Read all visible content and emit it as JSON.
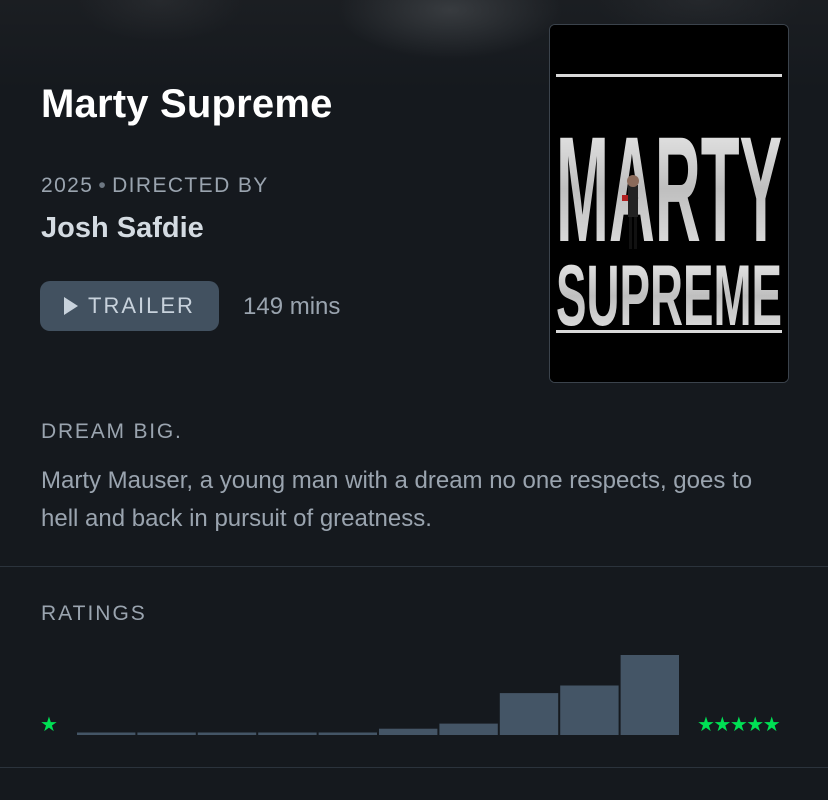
{
  "film": {
    "title": "Marty Supreme",
    "year": "2025",
    "directed_by_label": "DIRECTED BY",
    "director": "Josh Safdie",
    "trailer_label": "TRAILER",
    "runtime": "149 mins",
    "tagline": "DREAM BIG.",
    "synopsis": "Marty Mauser, a young man with a dream no one respects, goes to hell and back in pursuit of greatness."
  },
  "poster": {
    "line1": "MARTY",
    "line2": "SUPREME"
  },
  "ratings": {
    "label": "RATINGS",
    "min_star": "★",
    "max_stars": "★★★★★"
  },
  "colors": {
    "accent_green": "#00e054",
    "bar": "#445566",
    "background": "#15191e"
  },
  "icons": {
    "play": "play-icon"
  },
  "chart_data": {
    "type": "bar",
    "categories": [
      "0.5",
      "1",
      "1.5",
      "2",
      "2.5",
      "3",
      "3.5",
      "4",
      "4.5",
      "5"
    ],
    "values": [
      2,
      2,
      2,
      2,
      2,
      5,
      9,
      33,
      39,
      63
    ],
    "title": "",
    "xlabel": "",
    "ylabel": "",
    "ylim": [
      0,
      63
    ]
  }
}
